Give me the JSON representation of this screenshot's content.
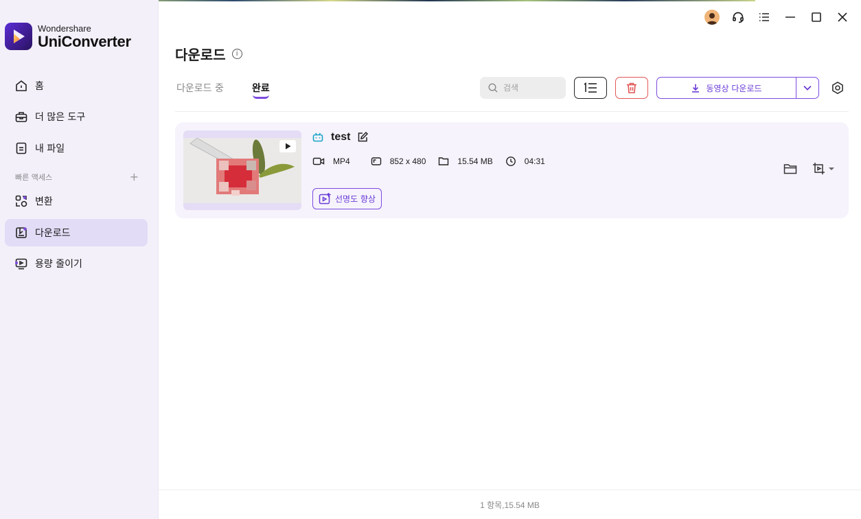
{
  "app": {
    "brand_small": "Wondershare",
    "brand_big": "UniConverter",
    "accent_color": "#7b4ae0"
  },
  "sidebar": {
    "items": [
      {
        "label": "홈",
        "icon": "home-icon"
      },
      {
        "label": "더 많은 도구",
        "icon": "toolbox-icon"
      },
      {
        "label": "내 파일",
        "icon": "file-icon"
      }
    ],
    "quick_access_label": "빠른 액세스",
    "quick_access_add": "+",
    "quick_items": [
      {
        "label": "변환",
        "icon": "convert-icon"
      },
      {
        "label": "다운로드",
        "icon": "download-icon",
        "active": true
      },
      {
        "label": "용량 줄이기",
        "icon": "compress-icon"
      }
    ]
  },
  "page": {
    "title": "다운로드",
    "info": "i"
  },
  "tabs": {
    "downloading": "다운로드 중",
    "done": "완료"
  },
  "toolbar": {
    "search_placeholder": "검색",
    "download_video_label": "동영상 다운로드"
  },
  "items": [
    {
      "name": "test",
      "format": "MP4",
      "resolution": "852 x 480",
      "size": "15.54 MB",
      "duration": "04:31",
      "enhance_label": "선명도 향상"
    }
  ],
  "footer": {
    "summary": "1 항목,15.54 MB"
  }
}
